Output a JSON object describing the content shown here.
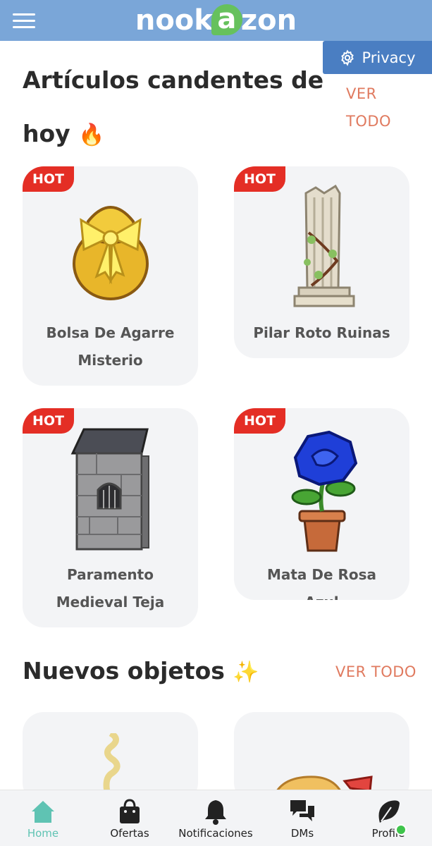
{
  "header": {
    "logo_text_a": "nook",
    "logo_leaf": "a",
    "logo_text_b": "zon"
  },
  "privacy": {
    "label": "Privacy",
    "icon": "gear-icon"
  },
  "hot_section": {
    "title_line1": "Artículos candentes de",
    "title_line2": "hoy",
    "emoji": "🔥",
    "see_all_line1": "VER",
    "see_all_line2": "TODO",
    "items": [
      {
        "badge": "HOT",
        "name": "Bolsa De Agarre Misterio",
        "icon": "gift-bag-icon"
      },
      {
        "badge": "HOT",
        "name": "Pilar Roto Ruinas",
        "icon": "broken-pillar-icon"
      },
      {
        "badge": "HOT",
        "name": "Paramento Medieval Teja",
        "icon": "medieval-wall-icon"
      },
      {
        "badge": "HOT",
        "name": "Mata De Rosa Azul",
        "icon": "blue-rose-icon"
      }
    ]
  },
  "new_section": {
    "title": "Nuevos objetos",
    "emoji": "✨",
    "see_all": "VER TODO"
  },
  "bottom_nav": [
    {
      "label": "Home",
      "icon": "home-icon",
      "active": true
    },
    {
      "label": "Ofertas",
      "icon": "bag-icon"
    },
    {
      "label": "Notificaciones",
      "icon": "bell-icon"
    },
    {
      "label": "DMs",
      "icon": "chat-icon"
    },
    {
      "label": "Profile",
      "icon": "leaf-icon"
    }
  ],
  "colors": {
    "header": "#7aa6d8",
    "privacy": "#4a7ec2",
    "hot": "#e42e25",
    "see_all": "#e07a5f",
    "active_nav": "#5fc3b3",
    "online": "#3ec44b"
  }
}
